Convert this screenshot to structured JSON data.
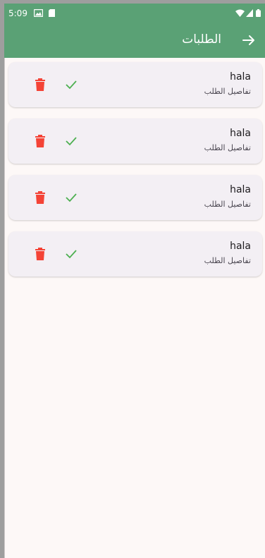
{
  "status_bar": {
    "time": "5:09",
    "icons": [
      "image-icon",
      "sim-card-icon",
      "wifi-icon",
      "signal-icon",
      "battery-icon"
    ]
  },
  "app_bar": {
    "title": "الطلبات",
    "back_icon": "arrow-right-icon"
  },
  "orders": [
    {
      "name": "hala",
      "subtitle": "تفاصيل الطلب"
    },
    {
      "name": "hala",
      "subtitle": "تفاصيل الطلب"
    },
    {
      "name": "hala",
      "subtitle": "تفاصيل الطلب"
    },
    {
      "name": "hala",
      "subtitle": "تفاصيل الطلب"
    }
  ],
  "colors": {
    "app_bar": "#5aa175",
    "accept": "#4caf50",
    "delete": "#f44336",
    "card": "#f3eff4",
    "background": "#fdf8f7"
  }
}
